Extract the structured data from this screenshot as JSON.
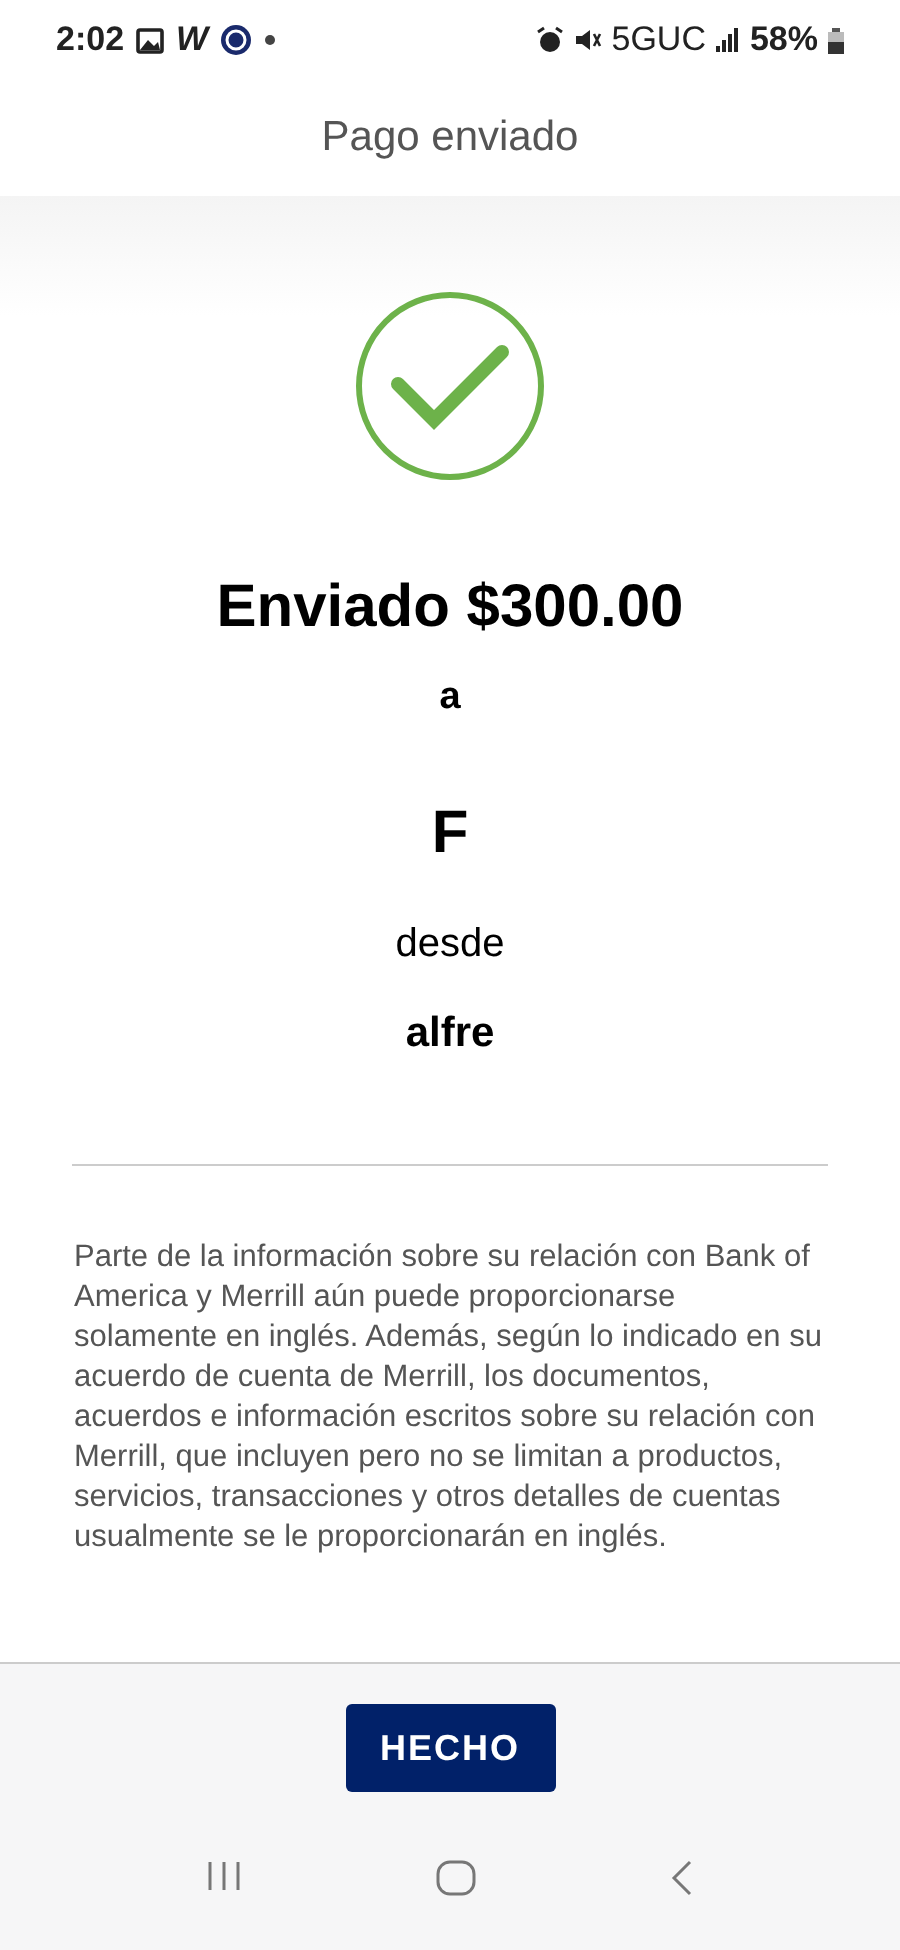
{
  "status_bar": {
    "time": "2:02",
    "app_letter": "W",
    "network": "5GUC",
    "battery": "58%"
  },
  "header": {
    "title": "Pago enviado"
  },
  "confirmation": {
    "amount_line": "Enviado $300.00",
    "to_label": "a",
    "recipient": "F",
    "from_label": "desde",
    "sender": "alfre"
  },
  "disclaimer": "Parte de la información sobre su relación con Bank of America y Merrill aún puede proporcionarse solamente en inglés. Además, según lo indicado en su acuerdo de cuenta de Merrill, los documentos, acuerdos e información escritos sobre su relación con Merrill, que incluyen pero no se limitan a productos, servicios, transacciones y otros detalles de cuentas usualmente se le proporcionarán en inglés.",
  "done_button": "HECHO"
}
